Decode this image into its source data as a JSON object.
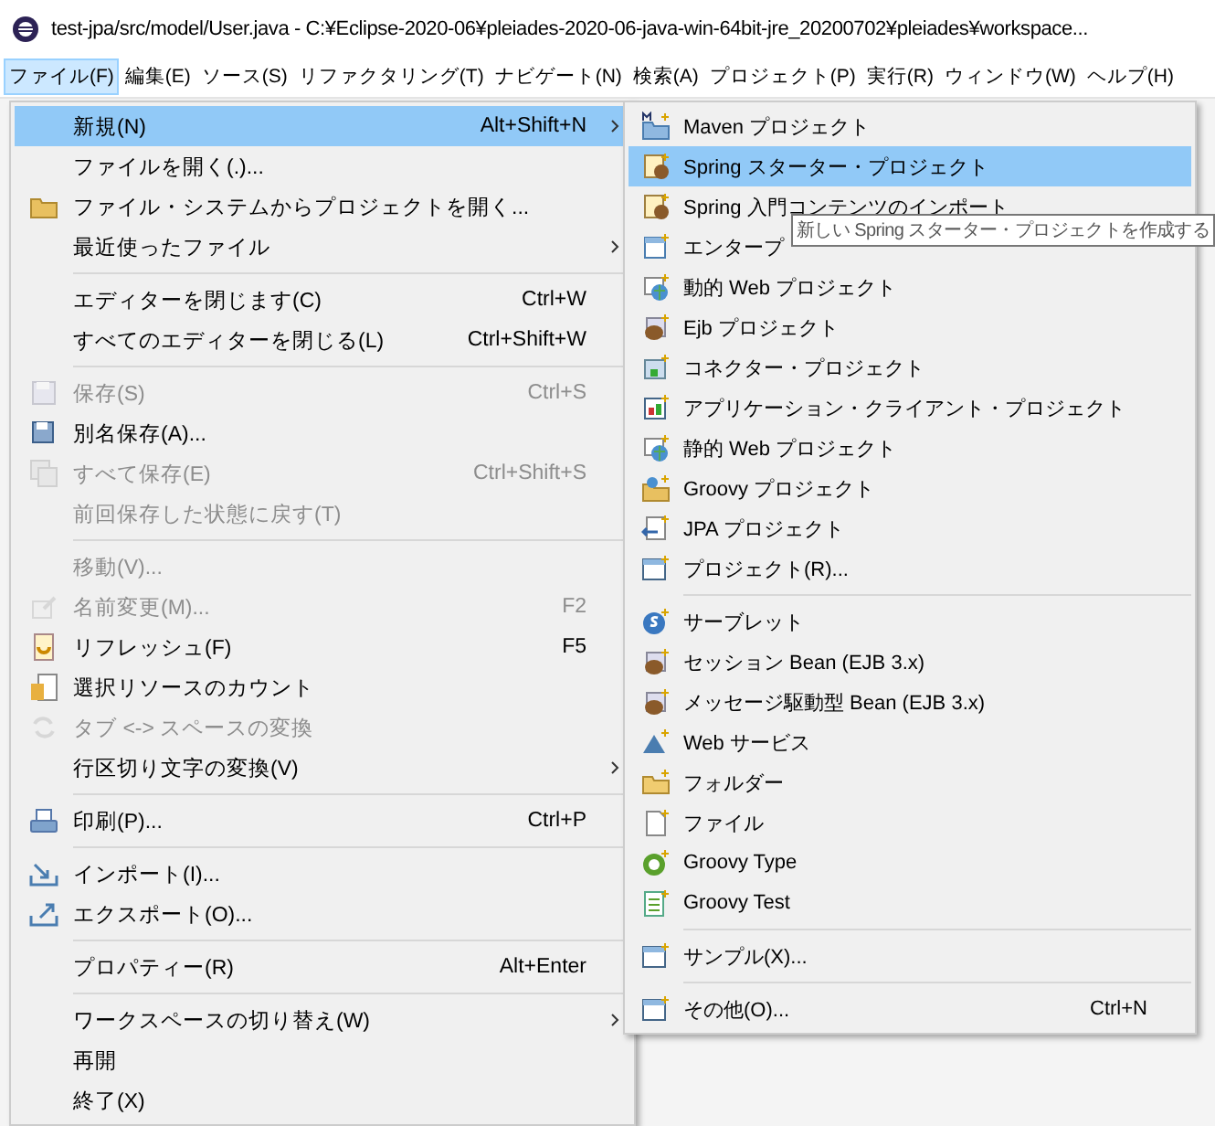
{
  "window": {
    "title": "test-jpa/src/model/User.java - C:¥Eclipse-2020-06¥pleiades-2020-06-java-win-64bit-jre_20200702¥pleiades¥workspace..."
  },
  "menubar": [
    {
      "label": "ファイル(F)",
      "selected": true
    },
    {
      "label": "編集(E)",
      "selected": false
    },
    {
      "label": "ソース(S)",
      "selected": false
    },
    {
      "label": "リファクタリング(T)",
      "selected": false
    },
    {
      "label": "ナビゲート(N)",
      "selected": false
    },
    {
      "label": "検索(A)",
      "selected": false
    },
    {
      "label": "プロジェクト(P)",
      "selected": false
    },
    {
      "label": "実行(R)",
      "selected": false
    },
    {
      "label": "ウィンドウ(W)",
      "selected": false
    },
    {
      "label": "ヘルプ(H)",
      "selected": false
    }
  ],
  "file_menu": [
    {
      "kind": "item",
      "label": "新規(N)",
      "shortcut": "Alt+Shift+N",
      "submenu": true,
      "selected": true,
      "disabled": false
    },
    {
      "kind": "item",
      "label": "ファイルを開く(.)...",
      "selected": false,
      "disabled": false
    },
    {
      "kind": "item",
      "label": "ファイル・システムからプロジェクトを開く...",
      "selected": false,
      "disabled": false
    },
    {
      "kind": "item",
      "label": "最近使ったファイル",
      "submenu": true,
      "selected": false,
      "disabled": false
    },
    {
      "kind": "separator"
    },
    {
      "kind": "item",
      "label": "エディターを閉じます(C)",
      "shortcut": "Ctrl+W",
      "selected": false,
      "disabled": false
    },
    {
      "kind": "item",
      "label": "すべてのエディターを閉じる(L)",
      "shortcut": "Ctrl+Shift+W",
      "selected": false,
      "disabled": false
    },
    {
      "kind": "separator"
    },
    {
      "kind": "item",
      "label": "保存(S)",
      "shortcut": "Ctrl+S",
      "selected": false,
      "disabled": true
    },
    {
      "kind": "item",
      "label": "別名保存(A)...",
      "selected": false,
      "disabled": false
    },
    {
      "kind": "item",
      "label": "すべて保存(E)",
      "shortcut": "Ctrl+Shift+S",
      "selected": false,
      "disabled": true
    },
    {
      "kind": "item",
      "label": "前回保存した状態に戻す(T)",
      "selected": false,
      "disabled": true
    },
    {
      "kind": "separator"
    },
    {
      "kind": "item",
      "label": "移動(V)...",
      "selected": false,
      "disabled": true
    },
    {
      "kind": "item",
      "label": "名前変更(M)...",
      "shortcut": "F2",
      "selected": false,
      "disabled": true
    },
    {
      "kind": "item",
      "label": "リフレッシュ(F)",
      "shortcut": "F5",
      "selected": false,
      "disabled": false
    },
    {
      "kind": "item",
      "label": "選択リソースのカウント",
      "selected": false,
      "disabled": false
    },
    {
      "kind": "item",
      "label": "タブ <-> スペースの変換",
      "selected": false,
      "disabled": true
    },
    {
      "kind": "item",
      "label": "行区切り文字の変換(V)",
      "submenu": true,
      "selected": false,
      "disabled": false
    },
    {
      "kind": "separator"
    },
    {
      "kind": "item",
      "label": "印刷(P)...",
      "shortcut": "Ctrl+P",
      "selected": false,
      "disabled": false
    },
    {
      "kind": "separator"
    },
    {
      "kind": "item",
      "label": "インポート(I)...",
      "selected": false,
      "disabled": false
    },
    {
      "kind": "item",
      "label": "エクスポート(O)...",
      "selected": false,
      "disabled": false
    },
    {
      "kind": "separator"
    },
    {
      "kind": "item",
      "label": "プロパティー(R)",
      "shortcut": "Alt+Enter",
      "selected": false,
      "disabled": false
    },
    {
      "kind": "separator"
    },
    {
      "kind": "item",
      "label": "ワークスペースの切り替え(W)",
      "submenu": true,
      "selected": false,
      "disabled": false
    },
    {
      "kind": "item",
      "label": "再開",
      "selected": false,
      "disabled": false
    },
    {
      "kind": "item",
      "label": "終了(X)",
      "selected": false,
      "disabled": false
    }
  ],
  "new_submenu": [
    {
      "kind": "item",
      "label": "Maven プロジェクト",
      "selected": false,
      "disabled": false
    },
    {
      "kind": "item",
      "label": "Spring スターター・プロジェクト",
      "selected": true,
      "disabled": false
    },
    {
      "kind": "item",
      "label": "Spring 入門コンテンツのインポート",
      "selected": false,
      "disabled": false
    },
    {
      "kind": "item",
      "label": "エンタープ",
      "selected": false,
      "disabled": false
    },
    {
      "kind": "item",
      "label": "動的 Web プロジェクト",
      "selected": false,
      "disabled": false
    },
    {
      "kind": "item",
      "label": "Ejb プロジェクト",
      "selected": false,
      "disabled": false
    },
    {
      "kind": "item",
      "label": "コネクター・プロジェクト",
      "selected": false,
      "disabled": false
    },
    {
      "kind": "item",
      "label": "アプリケーション・クライアント・プロジェクト",
      "selected": false,
      "disabled": false
    },
    {
      "kind": "item",
      "label": "静的 Web プロジェクト",
      "selected": false,
      "disabled": false
    },
    {
      "kind": "item",
      "label": "Groovy プロジェクト",
      "selected": false,
      "disabled": false
    },
    {
      "kind": "item",
      "label": "JPA プロジェクト",
      "selected": false,
      "disabled": false
    },
    {
      "kind": "item",
      "label": "プロジェクト(R)...",
      "selected": false,
      "disabled": false
    },
    {
      "kind": "separator"
    },
    {
      "kind": "item",
      "label": "サーブレット",
      "selected": false,
      "disabled": false
    },
    {
      "kind": "item",
      "label": "セッション Bean (EJB 3.x)",
      "selected": false,
      "disabled": false
    },
    {
      "kind": "item",
      "label": "メッセージ駆動型 Bean (EJB 3.x)",
      "selected": false,
      "disabled": false
    },
    {
      "kind": "item",
      "label": "Web サービス",
      "selected": false,
      "disabled": false
    },
    {
      "kind": "item",
      "label": "フォルダー",
      "selected": false,
      "disabled": false
    },
    {
      "kind": "item",
      "label": "ファイル",
      "selected": false,
      "disabled": false
    },
    {
      "kind": "item",
      "label": "Groovy Type",
      "selected": false,
      "disabled": false
    },
    {
      "kind": "item",
      "label": "Groovy Test",
      "selected": false,
      "disabled": false
    },
    {
      "kind": "separator"
    },
    {
      "kind": "item",
      "label": "サンプル(X)...",
      "selected": false,
      "disabled": false
    },
    {
      "kind": "separator"
    },
    {
      "kind": "item",
      "label": "その他(O)...",
      "shortcut": "Ctrl+N",
      "selected": false,
      "disabled": false
    }
  ],
  "tooltip": "新しい Spring スターター・プロジェクトを作成する"
}
